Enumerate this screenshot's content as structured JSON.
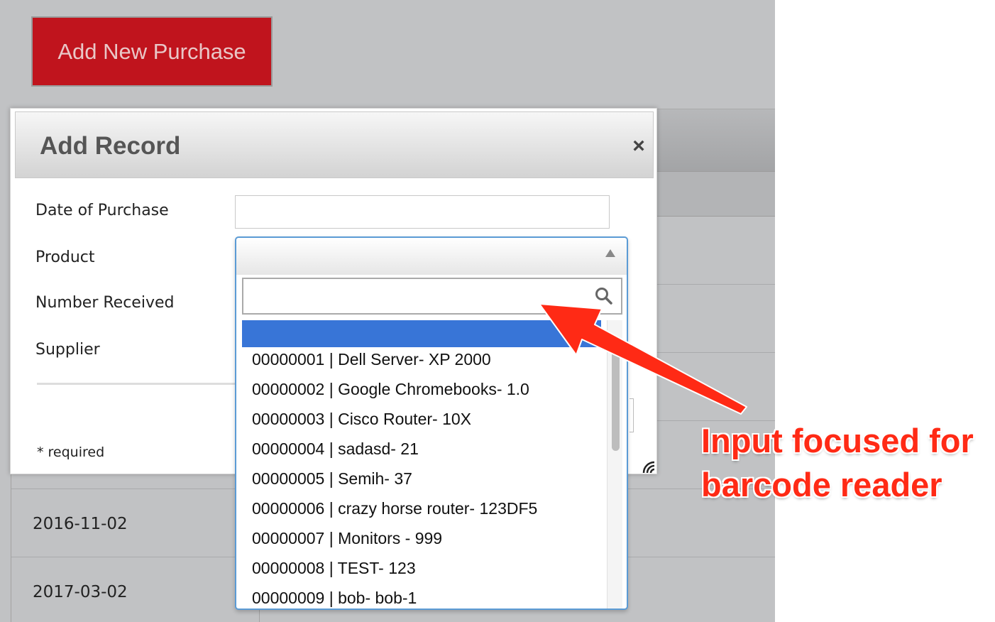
{
  "background": {
    "add_button_label": "Add New Purchase",
    "rows": [
      "2016-11-02",
      "2017-03-02"
    ]
  },
  "modal": {
    "title": "Add Record",
    "close_symbol": "×",
    "fields": {
      "date_label": "Date of Purchase",
      "product_label": "Product",
      "number_label": "Number Received",
      "supplier_label": "Supplier"
    },
    "date_value": "",
    "required_note": "* required"
  },
  "product_select": {
    "selected": "",
    "search_value": "",
    "options": [
      "00000001 | Dell Server- XP 2000",
      "00000002 | Google Chromebooks- 1.0",
      "00000003 | Cisco Router- 10X",
      "00000004 | sadasd- 21",
      "00000005 | Semih- 37",
      "00000006 | crazy horse router- 123DF5",
      "00000007 | Monitors - 999",
      "00000008 | TEST- 123",
      "00000009 | bob- bob-1"
    ]
  },
  "annotation": {
    "line1": "Input focused for",
    "line2": "barcode reader",
    "color": "#ff2a15"
  },
  "colors": {
    "accent_red": "#c0141d",
    "highlight_blue": "#3875d7",
    "focus_border": "#5b9bd5"
  }
}
